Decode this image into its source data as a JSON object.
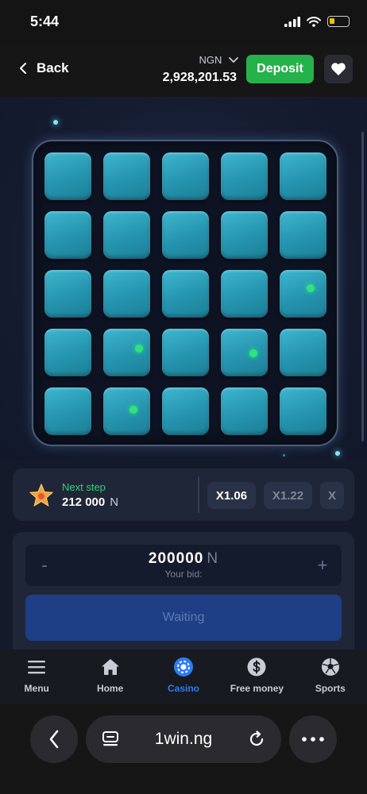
{
  "status_bar": {
    "time": "5:44"
  },
  "header": {
    "back_label": "Back",
    "currency": "NGN",
    "balance": "2,928,201.53",
    "deposit_label": "Deposit"
  },
  "game": {
    "rows": 5,
    "columns": 5,
    "marked_cells": [
      {
        "row": 3,
        "col": 5
      },
      {
        "row": 4,
        "col": 2
      },
      {
        "row": 4,
        "col": 4
      },
      {
        "row": 5,
        "col": 2
      }
    ],
    "colors": {
      "tile": "#2594ae",
      "marker": "#2ee47a"
    }
  },
  "next_step": {
    "label": "Next step",
    "amount": "212 000",
    "currency": "N",
    "multipliers": [
      "X1.06",
      "X1.22",
      "X"
    ]
  },
  "bet": {
    "minus": "-",
    "plus": "+",
    "amount": "200000",
    "currency": "N",
    "label": "Your bid:",
    "action": "Waiting"
  },
  "bottom_nav": {
    "items": [
      {
        "label": "Menu",
        "icon": "menu-icon"
      },
      {
        "label": "Home",
        "icon": "home-icon"
      },
      {
        "label": "Casino",
        "icon": "casino-icon",
        "active": true
      },
      {
        "label": "Free money",
        "icon": "dollar-icon"
      },
      {
        "label": "Sports",
        "icon": "soccer-ball-icon"
      }
    ]
  },
  "browser": {
    "url": "1win.ng"
  },
  "colors": {
    "accent_green": "#26b24b",
    "nav_active": "#2d7cf2",
    "next_step_green": "#2ed17a"
  }
}
